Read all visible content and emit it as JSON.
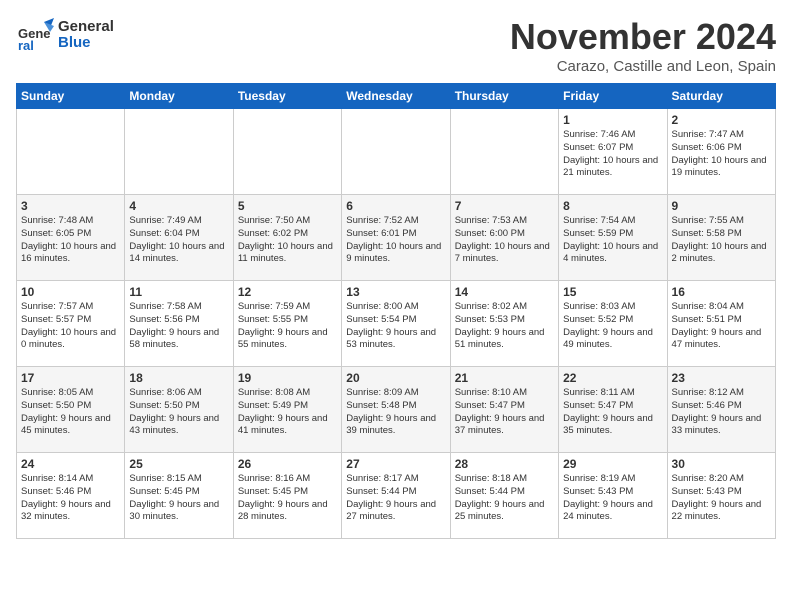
{
  "header": {
    "logo_line1": "General",
    "logo_line2": "Blue",
    "month_title": "November 2024",
    "subtitle": "Carazo, Castille and Leon, Spain"
  },
  "weekdays": [
    "Sunday",
    "Monday",
    "Tuesday",
    "Wednesday",
    "Thursday",
    "Friday",
    "Saturday"
  ],
  "weeks": [
    [
      {
        "day": "",
        "content": ""
      },
      {
        "day": "",
        "content": ""
      },
      {
        "day": "",
        "content": ""
      },
      {
        "day": "",
        "content": ""
      },
      {
        "day": "",
        "content": ""
      },
      {
        "day": "1",
        "content": "Sunrise: 7:46 AM\nSunset: 6:07 PM\nDaylight: 10 hours and 21 minutes."
      },
      {
        "day": "2",
        "content": "Sunrise: 7:47 AM\nSunset: 6:06 PM\nDaylight: 10 hours and 19 minutes."
      }
    ],
    [
      {
        "day": "3",
        "content": "Sunrise: 7:48 AM\nSunset: 6:05 PM\nDaylight: 10 hours and 16 minutes."
      },
      {
        "day": "4",
        "content": "Sunrise: 7:49 AM\nSunset: 6:04 PM\nDaylight: 10 hours and 14 minutes."
      },
      {
        "day": "5",
        "content": "Sunrise: 7:50 AM\nSunset: 6:02 PM\nDaylight: 10 hours and 11 minutes."
      },
      {
        "day": "6",
        "content": "Sunrise: 7:52 AM\nSunset: 6:01 PM\nDaylight: 10 hours and 9 minutes."
      },
      {
        "day": "7",
        "content": "Sunrise: 7:53 AM\nSunset: 6:00 PM\nDaylight: 10 hours and 7 minutes."
      },
      {
        "day": "8",
        "content": "Sunrise: 7:54 AM\nSunset: 5:59 PM\nDaylight: 10 hours and 4 minutes."
      },
      {
        "day": "9",
        "content": "Sunrise: 7:55 AM\nSunset: 5:58 PM\nDaylight: 10 hours and 2 minutes."
      }
    ],
    [
      {
        "day": "10",
        "content": "Sunrise: 7:57 AM\nSunset: 5:57 PM\nDaylight: 10 hours and 0 minutes."
      },
      {
        "day": "11",
        "content": "Sunrise: 7:58 AM\nSunset: 5:56 PM\nDaylight: 9 hours and 58 minutes."
      },
      {
        "day": "12",
        "content": "Sunrise: 7:59 AM\nSunset: 5:55 PM\nDaylight: 9 hours and 55 minutes."
      },
      {
        "day": "13",
        "content": "Sunrise: 8:00 AM\nSunset: 5:54 PM\nDaylight: 9 hours and 53 minutes."
      },
      {
        "day": "14",
        "content": "Sunrise: 8:02 AM\nSunset: 5:53 PM\nDaylight: 9 hours and 51 minutes."
      },
      {
        "day": "15",
        "content": "Sunrise: 8:03 AM\nSunset: 5:52 PM\nDaylight: 9 hours and 49 minutes."
      },
      {
        "day": "16",
        "content": "Sunrise: 8:04 AM\nSunset: 5:51 PM\nDaylight: 9 hours and 47 minutes."
      }
    ],
    [
      {
        "day": "17",
        "content": "Sunrise: 8:05 AM\nSunset: 5:50 PM\nDaylight: 9 hours and 45 minutes."
      },
      {
        "day": "18",
        "content": "Sunrise: 8:06 AM\nSunset: 5:50 PM\nDaylight: 9 hours and 43 minutes."
      },
      {
        "day": "19",
        "content": "Sunrise: 8:08 AM\nSunset: 5:49 PM\nDaylight: 9 hours and 41 minutes."
      },
      {
        "day": "20",
        "content": "Sunrise: 8:09 AM\nSunset: 5:48 PM\nDaylight: 9 hours and 39 minutes."
      },
      {
        "day": "21",
        "content": "Sunrise: 8:10 AM\nSunset: 5:47 PM\nDaylight: 9 hours and 37 minutes."
      },
      {
        "day": "22",
        "content": "Sunrise: 8:11 AM\nSunset: 5:47 PM\nDaylight: 9 hours and 35 minutes."
      },
      {
        "day": "23",
        "content": "Sunrise: 8:12 AM\nSunset: 5:46 PM\nDaylight: 9 hours and 33 minutes."
      }
    ],
    [
      {
        "day": "24",
        "content": "Sunrise: 8:14 AM\nSunset: 5:46 PM\nDaylight: 9 hours and 32 minutes."
      },
      {
        "day": "25",
        "content": "Sunrise: 8:15 AM\nSunset: 5:45 PM\nDaylight: 9 hours and 30 minutes."
      },
      {
        "day": "26",
        "content": "Sunrise: 8:16 AM\nSunset: 5:45 PM\nDaylight: 9 hours and 28 minutes."
      },
      {
        "day": "27",
        "content": "Sunrise: 8:17 AM\nSunset: 5:44 PM\nDaylight: 9 hours and 27 minutes."
      },
      {
        "day": "28",
        "content": "Sunrise: 8:18 AM\nSunset: 5:44 PM\nDaylight: 9 hours and 25 minutes."
      },
      {
        "day": "29",
        "content": "Sunrise: 8:19 AM\nSunset: 5:43 PM\nDaylight: 9 hours and 24 minutes."
      },
      {
        "day": "30",
        "content": "Sunrise: 8:20 AM\nSunset: 5:43 PM\nDaylight: 9 hours and 22 minutes."
      }
    ]
  ]
}
